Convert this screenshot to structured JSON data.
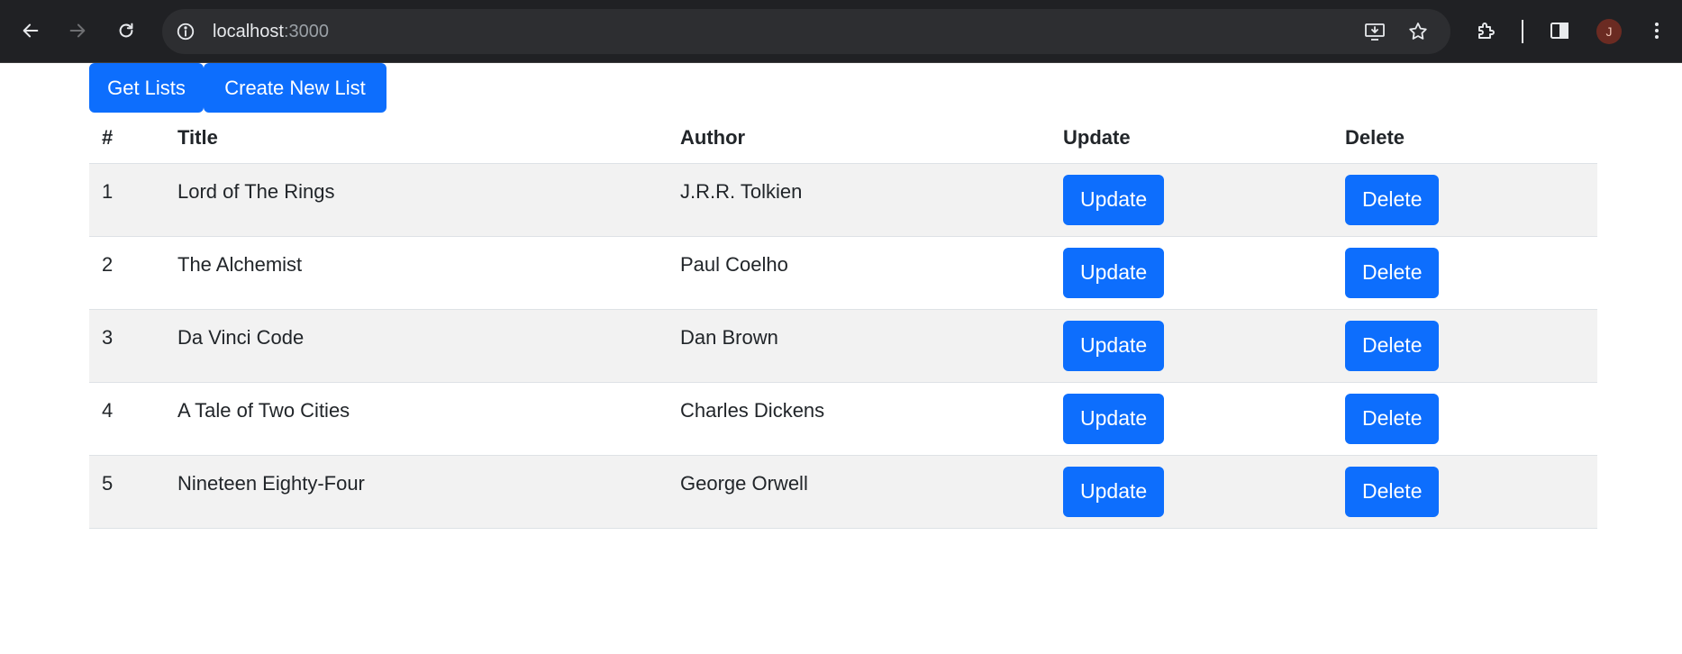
{
  "browser": {
    "url_host": "localhost",
    "url_port": ":3000",
    "avatar_initial": "J"
  },
  "toolbar": {
    "get_lists_label": "Get Lists",
    "create_list_label": "Create New List"
  },
  "table": {
    "headers": [
      "#",
      "Title",
      "Author",
      "Update",
      "Delete"
    ],
    "rows": [
      {
        "num": "1",
        "title": "Lord of The Rings",
        "author": "J.R.R. Tolkien",
        "update": "Update",
        "delete": "Delete"
      },
      {
        "num": "2",
        "title": "The Alchemist",
        "author": "Paul Coelho",
        "update": "Update",
        "delete": "Delete"
      },
      {
        "num": "3",
        "title": "Da Vinci Code",
        "author": "Dan Brown",
        "update": "Update",
        "delete": "Delete"
      },
      {
        "num": "4",
        "title": "A Tale of Two Cities",
        "author": "Charles Dickens",
        "update": "Update",
        "delete": "Delete"
      },
      {
        "num": "5",
        "title": "Nineteen Eighty-Four",
        "author": "George Orwell",
        "update": "Update",
        "delete": "Delete"
      }
    ]
  },
  "colors": {
    "primary": "#0d6efd",
    "stripe": "#f2f2f2",
    "chrome_bg": "#202124"
  }
}
